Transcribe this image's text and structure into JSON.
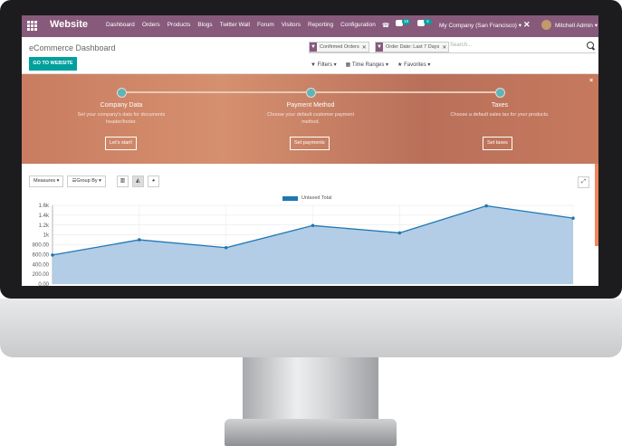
{
  "topbar": {
    "brand": "Website",
    "menu": [
      "Dashboard",
      "Orders",
      "Products",
      "Blogs",
      "Twitter Wall",
      "Forum",
      "Visitors",
      "Reporting",
      "Configuration"
    ],
    "activity_badge": "18",
    "message_badge": "6",
    "company": "My Company (San Francisco)",
    "user": "Mitchell Admin"
  },
  "control_panel": {
    "breadcrumb": "eCommerce Dashboard",
    "go_to_website": "GO TO WEBSITE",
    "facets": [
      "Confirmed Orders",
      "Order Date: Last 7 Days"
    ],
    "search_placeholder": "Search...",
    "filters_label": "Filters",
    "time_ranges_label": "Time Ranges",
    "favorites_label": "Favorites"
  },
  "onboarding": {
    "steps": [
      {
        "title": "Company Data",
        "desc": "Set your company's data for documents header/footer.",
        "button": "Let's start!"
      },
      {
        "title": "Payment Method",
        "desc": "Choose your default customer payment method.",
        "button": "Set payments"
      },
      {
        "title": "Taxes",
        "desc": "Choose a default sales tax for your products.",
        "button": "Set taxes"
      }
    ],
    "close": "×"
  },
  "graph_controls": {
    "measures": "Measures",
    "group_by": "Group By"
  },
  "colors": {
    "topbar": "#875a7b",
    "accent": "#00a09d",
    "banner": "#c97c60",
    "series": "#1f77b4",
    "area": "#aac8e2"
  },
  "chart_data": {
    "type": "area",
    "series": [
      {
        "name": "Untaxed Total",
        "values": [
          590,
          900,
          740,
          1190,
          1040,
          1590,
          1340
        ]
      }
    ],
    "y_ticks": [
      "1.6k",
      "1.4k",
      "1.2k",
      "1k",
      "800.00",
      "600.00",
      "400.00",
      "200.00",
      "0.00"
    ],
    "ylim": [
      0,
      1600
    ],
    "grid": true,
    "legend_position": "top-center"
  }
}
